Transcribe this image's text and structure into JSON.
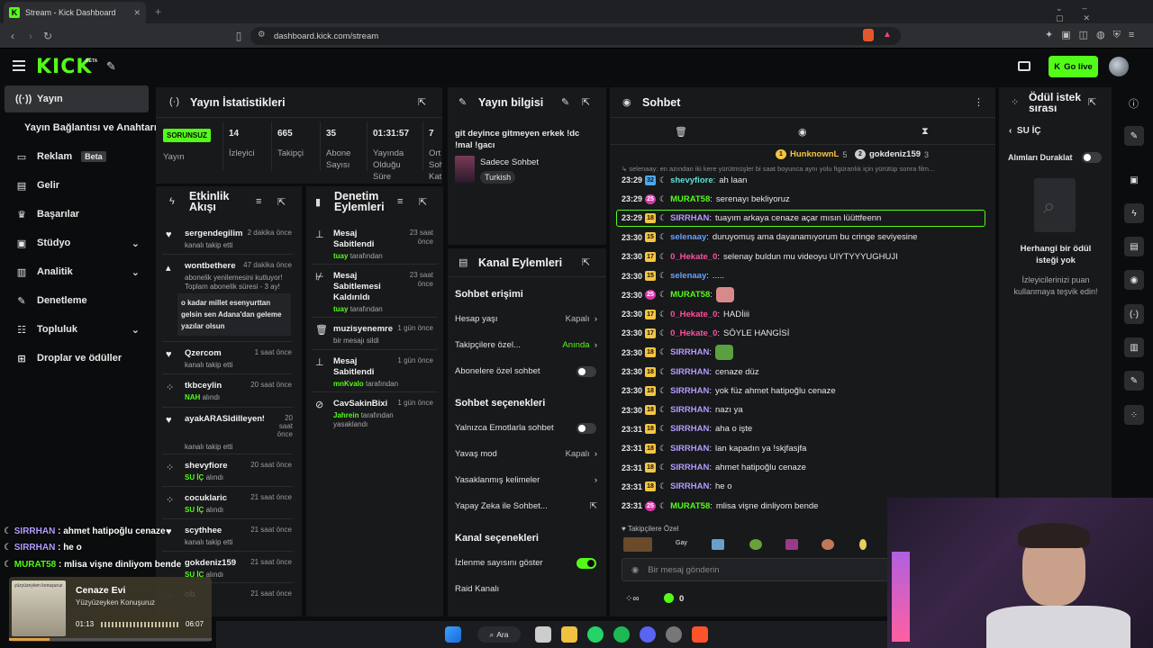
{
  "browser": {
    "tab_title": "Stream - Kick Dashboard",
    "url": "dashboard.kick.com/stream"
  },
  "header": {
    "logo": "KICK",
    "logo_badge": "BETA",
    "go_live": "Go live"
  },
  "sidebar": {
    "items": [
      {
        "label": "Yayın",
        "icon": "broadcast-icon"
      },
      {
        "label": "Yayın Bağlantısı ve Anahtarı",
        "icon": ""
      },
      {
        "label": "Reklam",
        "badge": "Beta",
        "icon": "monitor-icon"
      },
      {
        "label": "Gelir",
        "icon": "chart-icon"
      },
      {
        "label": "Başarılar",
        "icon": "trophy-icon"
      },
      {
        "label": "Stüdyo",
        "icon": "studio-icon"
      },
      {
        "label": "Analitik",
        "icon": "analytics-icon"
      },
      {
        "label": "Denetleme",
        "icon": "wrench-icon"
      },
      {
        "label": "Topluluk",
        "icon": "community-icon"
      },
      {
        "label": "Droplar ve ödüller",
        "icon": "gift-icon"
      }
    ]
  },
  "stats": {
    "title": "Yayın İstatistikleri",
    "status_badge": "SORUNSUZ",
    "status_label": "Yayın",
    "items": [
      {
        "value": "14",
        "label": "İzleyici"
      },
      {
        "value": "665",
        "label": "Takipçi"
      },
      {
        "value": "35",
        "label": "Abone Sayısı"
      },
      {
        "value": "01:31:57",
        "label": "Yayında Olduğu Süre"
      },
      {
        "value": "7",
        "label": "Ort Soh Kat"
      }
    ]
  },
  "stream_info": {
    "title": "Yayın bilgisi",
    "stream_title": "git deyince gitmeyen erkek !dc !mal !gacı",
    "category": "Sadece Sohbet",
    "tag": "Turkish"
  },
  "activity": {
    "title": "Etkinlik Akışı",
    "items": [
      {
        "name": "sergendegilim",
        "time": "2 dakika önce",
        "sub": "kanalı takip etti",
        "icon": "heart-icon"
      },
      {
        "name": "wontbethere",
        "time": "47 dakika önce",
        "sub": "abonelik yenilemesini kutluyor! Toplam abonelik süresi - 3 ay!",
        "message": "o kadar millet esenyurttan gelsin sen Adana'dan geleme yazılar olsun",
        "icon": "star-icon"
      },
      {
        "name": "Qzercom",
        "time": "1 saat önce",
        "sub": "kanalı takip etti",
        "icon": "heart-icon"
      },
      {
        "name": "tkbceylin",
        "time": "20 saat önce",
        "sub_accent": "NAH",
        "sub": "alındı",
        "icon": "reward-icon"
      },
      {
        "name": "ayakARASIdilleyen55",
        "time": "20 saat önce",
        "sub": "kanalı takip etti",
        "icon": "heart-icon"
      },
      {
        "name": "shevyfiore",
        "time": "20 saat önce",
        "sub_accent": "SU İÇ",
        "sub": "alındı",
        "icon": "reward-icon"
      },
      {
        "name": "cocuklaric",
        "time": "21 saat önce",
        "sub_accent": "SU İÇ",
        "sub": "alındı",
        "icon": "reward-icon"
      },
      {
        "name": "scythhee",
        "time": "21 saat önce",
        "sub": "kanalı takip etti",
        "icon": "heart-icon"
      },
      {
        "name": "gokdeniz159",
        "time": "21 saat önce",
        "sub_accent": "SU İÇ",
        "sub": "alındı",
        "icon": "reward-icon"
      },
      {
        "name": "ob",
        "time": "21 saat önce",
        "sub": "",
        "icon": "reward-icon"
      }
    ]
  },
  "moderation": {
    "title": "Denetim Eylemleri",
    "items": [
      {
        "action": "Mesaj Sabitlendi",
        "time": "23 saat önce",
        "actor": "tuay",
        "suffix": "tarafından",
        "icon": "pin-icon"
      },
      {
        "action": "Mesaj Sabitlemesi Kaldırıldı",
        "time": "23 saat önce",
        "actor": "tuay",
        "suffix": "tarafından",
        "icon": "unpin-icon"
      },
      {
        "action": "muzisyenemre",
        "time": "1 gün önce",
        "actor": "",
        "suffix": "bir mesajı sildi",
        "icon": "trash-icon"
      },
      {
        "action": "Mesaj Sabitlendi",
        "time": "1 gün önce",
        "actor": "mnKvalo",
        "suffix": "tarafından",
        "icon": "pin-icon"
      },
      {
        "action": "CavSakinBixi",
        "time": "1 gün önce",
        "actor": "Jahrein",
        "suffix": "tarafından yasaklandı",
        "icon": "ban-icon"
      }
    ]
  },
  "channel_actions": {
    "title": "Kanal Eylemleri",
    "chat_access": "Sohbet erişimi",
    "account_age": {
      "label": "Hesap yaşı",
      "value": "Kapalı"
    },
    "followers_only": {
      "label": "Takipçilere özel...",
      "value": "Anında"
    },
    "subs_only": {
      "label": "Abonelere özel sohbet"
    },
    "chat_options": "Sohbet seçenekleri",
    "emotes_only": {
      "label": "Yalnızca Emotlarla sohbet"
    },
    "slow_mode": {
      "label": "Yavaş mod",
      "value": "Kapalı"
    },
    "banned_words": {
      "label": "Yasaklanmış kelimeler"
    },
    "ai_chat": {
      "label": "Yapay Zeka ile Sohbet..."
    },
    "channel_options": "Kanal seçenekleri",
    "show_viewers": {
      "label": "İzlenme sayısını göster"
    },
    "raid": {
      "label": "Raid Kanalı"
    }
  },
  "chat": {
    "title": "Sohbet",
    "leaders": [
      {
        "rank": "1",
        "name": "HunknownL",
        "count": "5"
      },
      {
        "rank": "2",
        "name": "gokdeniz159",
        "count": "3"
      }
    ],
    "reply_preview": "selenaay: en azından iki kere yürütmüşler bi saat boyunca aynı yolu figüranlık için yürütüp sonra film...",
    "messages": [
      {
        "time": "23:29",
        "badge": "32",
        "btype": "b-b",
        "user": "shevyfiore",
        "color": "#5fe0d6",
        "text": "ah laan"
      },
      {
        "time": "23:29",
        "badge": "25",
        "btype": "b-p",
        "user": "MURAT58",
        "color": "#53fc18",
        "text": "serenayı bekliyoruz"
      },
      {
        "time": "23:29",
        "badge": "18",
        "btype": "b-y",
        "user": "SIRRHAN",
        "color": "#b39bff",
        "text": "tuayım arkaya cenaze açar mısın lüüttfeenn",
        "highlight": "yes"
      },
      {
        "time": "23:30",
        "badge": "15",
        "btype": "b-y",
        "user": "selenaay",
        "color": "#66a3ff",
        "text": "duruyomuş ama dayanamıyorum bu cringe seviyesine"
      },
      {
        "time": "23:30",
        "badge": "17",
        "btype": "b-y",
        "user": "0_Hekate_0",
        "color": "#ff4fa0",
        "text": "selenay buldun mu videoyu UIYTYYYUGHUJI"
      },
      {
        "time": "23:30",
        "badge": "15",
        "btype": "b-y",
        "user": "selenaay",
        "color": "#66a3ff",
        "text": "....."
      },
      {
        "time": "23:30",
        "badge": "25",
        "btype": "b-p",
        "user": "MURAT58",
        "color": "#53fc18",
        "text": "",
        "emote": "lips-emote"
      },
      {
        "time": "23:30",
        "badge": "17",
        "btype": "b-y",
        "user": "0_Hekate_0",
        "color": "#ff4fa0",
        "text": "HADİiii"
      },
      {
        "time": "23:30",
        "badge": "17",
        "btype": "b-y",
        "user": "0_Hekate_0",
        "color": "#ff4fa0",
        "text": "SÖYLE HANGİSİ"
      },
      {
        "time": "23:30",
        "badge": "18",
        "btype": "b-y",
        "user": "SIRRHAN",
        "color": "#b39bff",
        "text": "",
        "emote": "frog-emote"
      },
      {
        "time": "23:30",
        "badge": "18",
        "btype": "b-y",
        "user": "SIRRHAN",
        "color": "#b39bff",
        "text": "cenaze düz"
      },
      {
        "time": "23:30",
        "badge": "18",
        "btype": "b-y",
        "user": "SIRRHAN",
        "color": "#b39bff",
        "text": "yok füz ahmet hatipoğlu cenaze"
      },
      {
        "time": "23:30",
        "badge": "18",
        "btype": "b-y",
        "user": "SIRRHAN",
        "color": "#b39bff",
        "text": "nazı ya"
      },
      {
        "time": "23:31",
        "badge": "18",
        "btype": "b-y",
        "user": "SIRRHAN",
        "color": "#b39bff",
        "text": "aha o işte"
      },
      {
        "time": "23:31",
        "badge": "18",
        "btype": "b-y",
        "user": "SIRRHAN",
        "color": "#b39bff",
        "text": "lan kapadın ya !skjfasjfa"
      },
      {
        "time": "23:31",
        "badge": "18",
        "btype": "b-y",
        "user": "SIRRHAN",
        "color": "#b39bff",
        "text": "ahmet hatipoğlu cenaze"
      },
      {
        "time": "23:31",
        "badge": "18",
        "btype": "b-y",
        "user": "SIRRHAN",
        "color": "#b39bff",
        "text": "he o"
      },
      {
        "time": "23:31",
        "badge": "25",
        "btype": "b-p",
        "user": "MURAT58",
        "color": "#53fc18",
        "text": "mlisa vişne dinliyom bende"
      }
    ],
    "followers_only_label": "Takipçilere Özel",
    "emote_gay": "Gay",
    "input_placeholder": "Bir mesaj gönderin",
    "points": "0"
  },
  "rewards": {
    "title": "Ödül istek sırası",
    "back_label": "SU İÇ",
    "pause_label": "Alımları Duraklat",
    "empty_title": "Herhangi bir ödül isteği yok",
    "empty_sub": "İzleyicilerinizi puan kullanmaya teşvik edin!"
  },
  "overlay": {
    "chat": [
      {
        "user": "SIRRHAN",
        "color": "#b39bff",
        "text": "ahmet hatipoğlu cenaze"
      },
      {
        "user": "SIRRHAN",
        "color": "#b39bff",
        "text": "he o"
      },
      {
        "user": "MURAT58",
        "color": "#53fc18",
        "text": "mlisa vişne dinliyom bende"
      }
    ],
    "music": {
      "title": "Cenaze Evi",
      "artist": "Yüzyüzeyken Konuşuruz",
      "cover_text": "yüzyüzeyken konuşuruz",
      "elapsed": "01:13",
      "duration": "06:07",
      "progress": 0.2
    }
  },
  "taskbar": {
    "search": "Ara"
  },
  "colors": {
    "accent": "#53fc18",
    "panel": "#18191b",
    "background": "#0b0c0d"
  }
}
